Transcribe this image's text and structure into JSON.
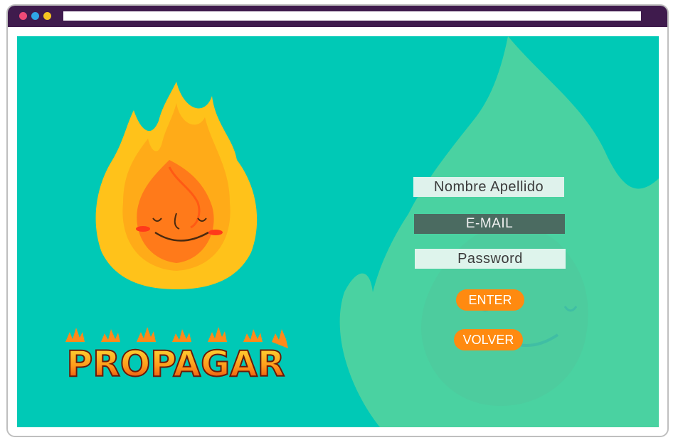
{
  "browser": {
    "window_dots": [
      "red",
      "blue",
      "yellow"
    ],
    "colors": {
      "frame": "#3f1b4d",
      "dot_red": "#ef4a77",
      "dot_blue": "#2fa6e6",
      "dot_yellow": "#f5c521"
    }
  },
  "brand": {
    "logo_text": "PROPAGAR",
    "mascot": "fire-mascot-icon"
  },
  "form": {
    "name_placeholder": "Nombre Apellido",
    "email_placeholder": "E-MAIL",
    "password_placeholder": "Password",
    "enter_label": "ENTER",
    "back_label": "VOLVER"
  },
  "colors": {
    "background": "#00c9b6",
    "button": "#ff8a10",
    "email_field": "#4b6b61",
    "light_field": "#dff2ec"
  }
}
